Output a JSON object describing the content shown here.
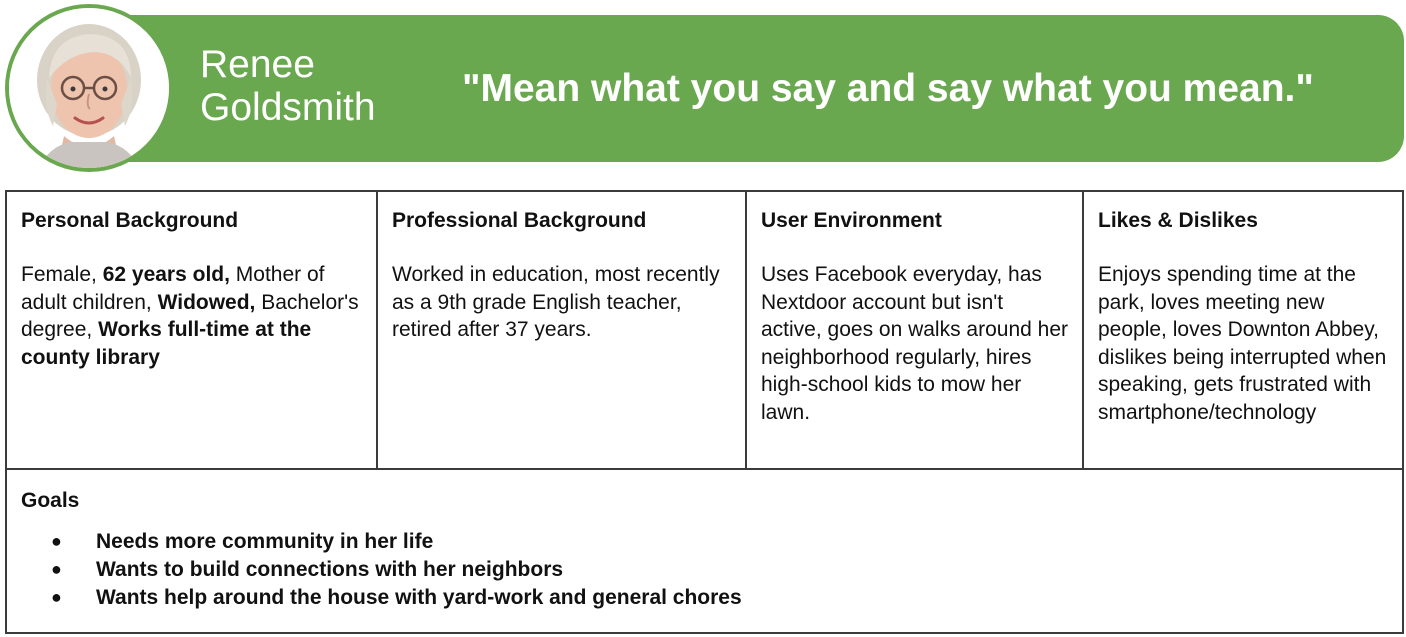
{
  "persona": {
    "name_first": "Renee",
    "name_last": "Goldsmith",
    "quote": "\"Mean what you say and say what you mean.\"",
    "avatar_icon": "portrait-photo",
    "accent_color": "#6aa84f"
  },
  "sections": [
    {
      "title": "Personal Background",
      "body": [
        {
          "text": "Female, ",
          "bold": false
        },
        {
          "text": "62 years old,",
          "bold": true
        },
        {
          "text": " Mother of adult children, ",
          "bold": false
        },
        {
          "text": "Widowed,",
          "bold": true
        },
        {
          "text": " Bachelor's degree, ",
          "bold": false
        },
        {
          "text": "Works full-time at the county library",
          "bold": true
        }
      ]
    },
    {
      "title": "Professional Background",
      "body": [
        {
          "text": "Worked in education, most recently as a 9th grade English teacher, retired after 37 years.",
          "bold": false
        }
      ]
    },
    {
      "title": "User Environment",
      "body": [
        {
          "text": "Uses Facebook everyday, has Nextdoor account but isn't active, goes on walks around her neighborhood regularly, hires high-school kids to mow her lawn.",
          "bold": false
        }
      ]
    },
    {
      "title": "Likes & Dislikes",
      "body": [
        {
          "text": "Enjoys spending time at the park, loves meeting new people, loves Downton Abbey, dislikes being interrupted when speaking, gets frustrated with smartphone/technology",
          "bold": false
        }
      ]
    }
  ],
  "goals": {
    "title": "Goals",
    "bullet": "●",
    "items": [
      "Needs more community in her life",
      "Wants to build connections with her neighbors",
      "Wants help around the house with yard-work and general chores"
    ]
  }
}
